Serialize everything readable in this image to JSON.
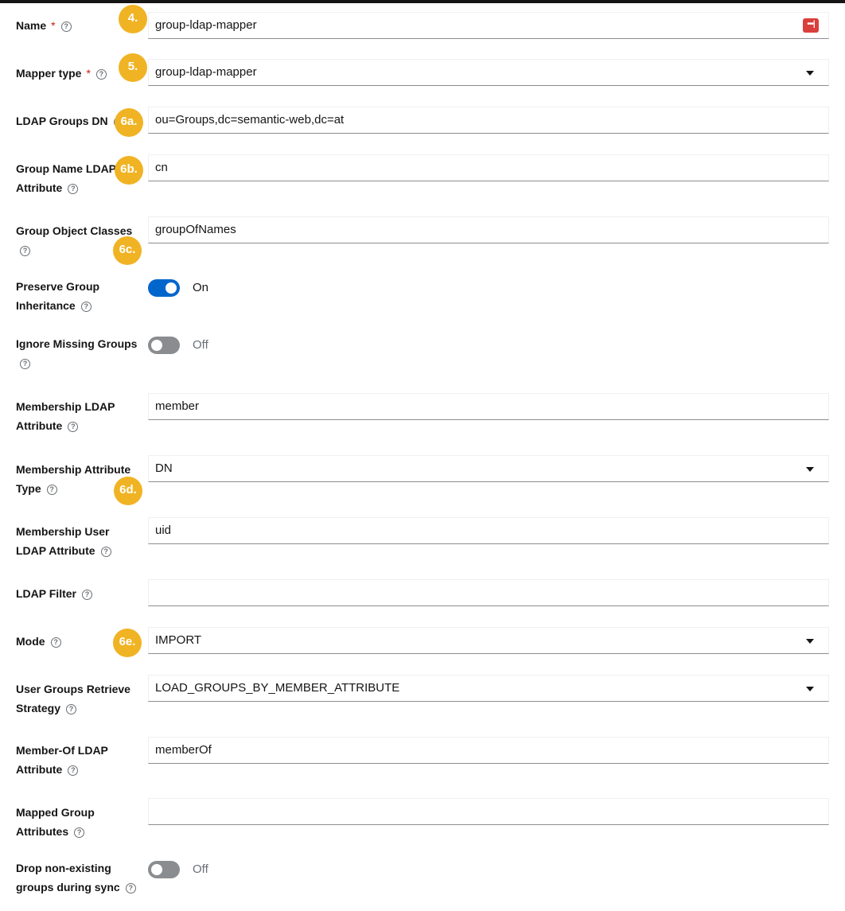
{
  "fields": [
    {
      "key": "name",
      "label": "Name",
      "required": true,
      "type": "text",
      "value": "group-ldap-mapper",
      "icon": "password-manager-icon",
      "badge": "4."
    },
    {
      "key": "mapper_type",
      "label": "Mapper type",
      "required": true,
      "type": "select",
      "value": "group-ldap-mapper",
      "badge": "5."
    },
    {
      "key": "ldap_groups_dn",
      "label": "LDAP Groups DN",
      "type": "text",
      "value": "ou=Groups,dc=semantic-web,dc=at",
      "badge": "6a."
    },
    {
      "key": "group_name_ldap_attribute",
      "label_line1": "Group Name LDAP",
      "label_line2": "Attribute",
      "type": "text",
      "value": "cn",
      "badge": "6b."
    },
    {
      "key": "group_object_classes",
      "label_line1": "Group Object Classes",
      "type": "text",
      "value": "groupOfNames",
      "badge": "6c."
    },
    {
      "key": "preserve_group_inheritance",
      "label_line1": "Preserve Group",
      "label_line2": "Inheritance",
      "type": "toggle",
      "state": "On"
    },
    {
      "key": "ignore_missing_groups",
      "label_line1": "Ignore Missing Groups",
      "type": "toggle",
      "state": "Off"
    },
    {
      "key": "membership_ldap_attribute",
      "label_line1": "Membership LDAP",
      "label_line2": "Attribute",
      "type": "text",
      "value": "member"
    },
    {
      "key": "membership_attribute_type",
      "label_line1": "Membership Attribute",
      "label_line2": "Type",
      "type": "select",
      "value": "DN",
      "badge": "6d."
    },
    {
      "key": "membership_user_ldap_attribute",
      "label_line1": "Membership User",
      "label_line2": "LDAP Attribute",
      "type": "text",
      "value": "uid"
    },
    {
      "key": "ldap_filter",
      "label": "LDAP Filter",
      "type": "text",
      "value": ""
    },
    {
      "key": "mode",
      "label": "Mode",
      "type": "select",
      "value": "IMPORT",
      "badge": "6e."
    },
    {
      "key": "user_groups_retrieve_strategy",
      "label_line1": "User Groups Retrieve",
      "label_line2": "Strategy",
      "type": "select",
      "value": "LOAD_GROUPS_BY_MEMBER_ATTRIBUTE"
    },
    {
      "key": "member_of_ldap_attribute",
      "label_line1": "Member-Of LDAP",
      "label_line2": "Attribute",
      "type": "text",
      "value": "memberOf"
    },
    {
      "key": "mapped_group_attributes",
      "label_line1": "Mapped Group",
      "label_line2": "Attributes",
      "type": "text",
      "value": ""
    },
    {
      "key": "drop_non_existing_groups",
      "label_line1": "Drop non-existing",
      "label_line2": "groups during sync",
      "type": "toggle",
      "state": "Off"
    }
  ],
  "help_glyph": "?",
  "required_glyph": "*",
  "password_icon_glyph": "•••|",
  "colors": {
    "badge": "#f0b323",
    "toggle_on": "#0066cc",
    "toggle_off": "#8a8d90",
    "required": "#c9190b"
  }
}
